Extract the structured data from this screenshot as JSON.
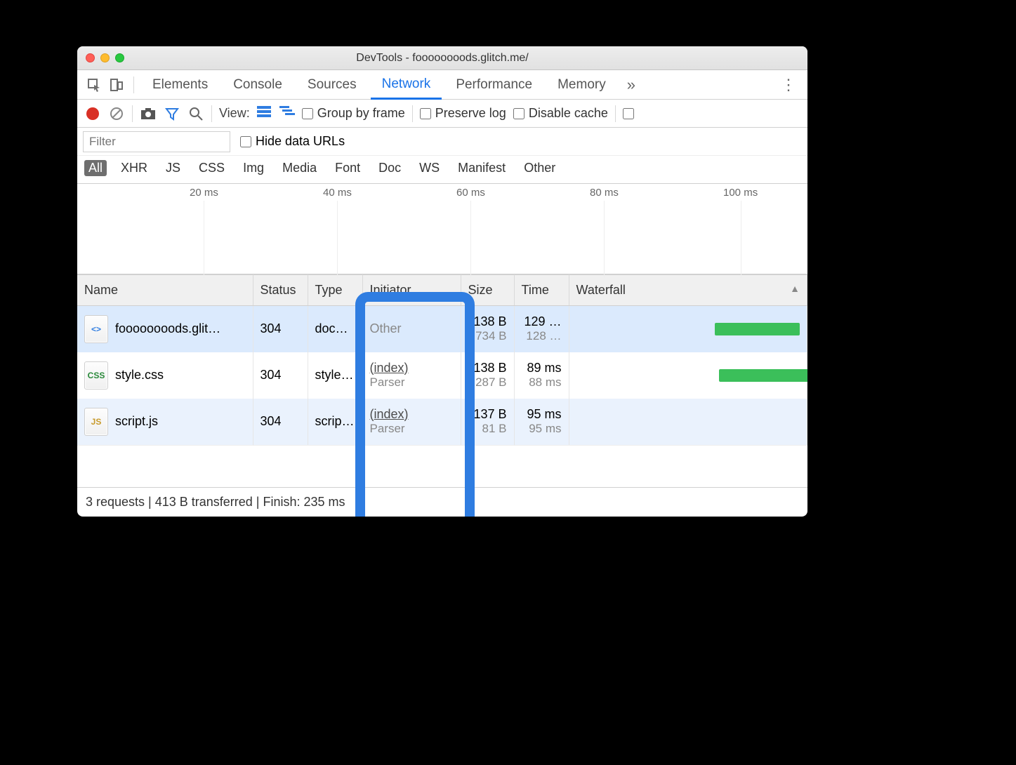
{
  "window": {
    "title": "DevTools - foooooooods.glitch.me/"
  },
  "tabs": {
    "items": [
      "Elements",
      "Console",
      "Sources",
      "Network",
      "Performance",
      "Memory"
    ],
    "active_index": 3,
    "overflow_glyph": "»",
    "kebab_glyph": "⋮"
  },
  "toolbar": {
    "view_label": "View:",
    "group_by_frame": "Group by frame",
    "preserve_log": "Preserve log",
    "disable_cache": "Disable cache"
  },
  "filter": {
    "placeholder": "Filter",
    "hide_data_urls": "Hide data URLs"
  },
  "types": {
    "items": [
      "All",
      "XHR",
      "JS",
      "CSS",
      "Img",
      "Media",
      "Font",
      "Doc",
      "WS",
      "Manifest",
      "Other"
    ],
    "active_index": 0
  },
  "timeline": {
    "ticks": [
      "20 ms",
      "40 ms",
      "60 ms",
      "80 ms",
      "100 ms"
    ]
  },
  "columns": {
    "name": "Name",
    "status": "Status",
    "type": "Type",
    "initiator": "Initiator",
    "size": "Size",
    "time": "Time",
    "waterfall": "Waterfall"
  },
  "rows": [
    {
      "icon": "doc",
      "icon_label": "<>",
      "name": "foooooooods.glit…",
      "status": "304",
      "type": "doc…",
      "initiator_top": "Other",
      "initiator_is_link": false,
      "initiator_sub": "",
      "size_top": "138 B",
      "size_sub": "734 B",
      "time_top": "129 …",
      "time_sub": "128 …",
      "wf_left_pct": 62,
      "wf_width_pct": 38
    },
    {
      "icon": "css",
      "icon_label": "CSS",
      "name": "style.css",
      "status": "304",
      "type": "style…",
      "initiator_top": "(index)",
      "initiator_is_link": true,
      "initiator_sub": "Parser",
      "size_top": "138 B",
      "size_sub": "287 B",
      "time_top": "89 ms",
      "time_sub": "88 ms",
      "wf_left_pct": 64,
      "wf_width_pct": 40
    },
    {
      "icon": "js",
      "icon_label": "JS",
      "name": "script.js",
      "status": "304",
      "type": "scrip…",
      "initiator_top": "(index)",
      "initiator_is_link": true,
      "initiator_sub": "Parser",
      "size_top": "137 B",
      "size_sub": "81 B",
      "time_top": "95 ms",
      "time_sub": "95 ms",
      "wf_left_pct": 0,
      "wf_width_pct": 0
    }
  ],
  "summary": {
    "text": "3 requests | 413 B transferred | Finish: 235 ms"
  },
  "icons": {
    "sort_arrow": "▲"
  }
}
